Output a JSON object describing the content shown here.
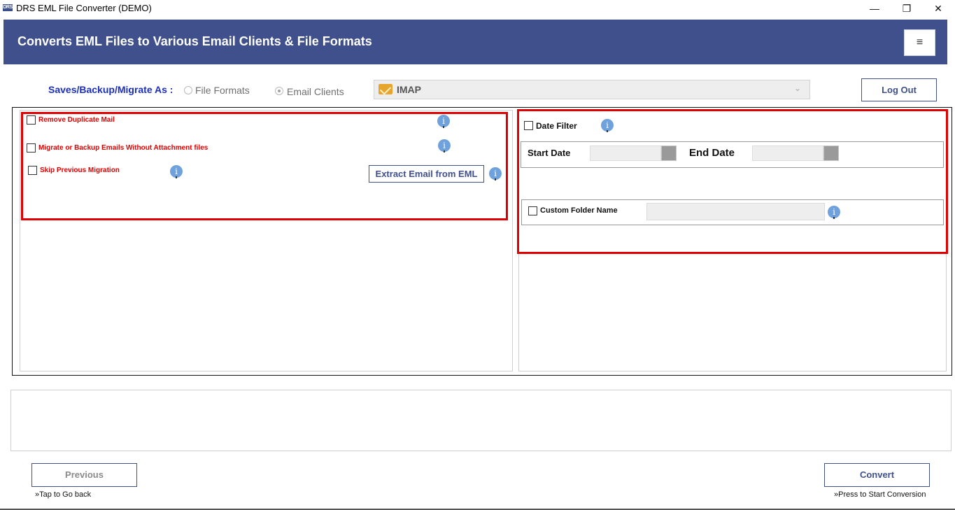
{
  "window": {
    "app_icon_text": "DRS",
    "title": "DRS EML File Converter (DEMO)",
    "minimize_glyph": "—",
    "maximize_glyph": "❐",
    "close_glyph": "✕"
  },
  "header": {
    "title": "Converts EML Files to Various Email Clients & File Formats",
    "menu_glyph": "≡",
    "background_color": "#40508c"
  },
  "saves": {
    "label": "Saves/Backup/Migrate As :",
    "options": [
      {
        "label": "File Formats",
        "selected": false
      },
      {
        "label": "Email Clients",
        "selected": true
      }
    ],
    "selected_client": "IMAP",
    "selected_client_icon": "imap-envelope-icon",
    "dropdown_glyph": "⌄"
  },
  "logout_label": "Log Out",
  "left_options": [
    {
      "label": "Remove Duplicate Mail",
      "checked": false
    },
    {
      "label": "Migrate or Backup Emails Without Attachment files",
      "checked": false
    },
    {
      "label": "Skip Previous Migration",
      "checked": false
    }
  ],
  "info_glyph": "i",
  "extract_label": "Extract Email from EML",
  "right_options": {
    "date_filter_label": "Date Filter",
    "date_filter_checked": false,
    "start_date_label": "Start Date",
    "start_date_value": "",
    "end_date_label": "End Date",
    "end_date_value": "",
    "custom_folder_label": "Custom Folder Name",
    "custom_folder_checked": false,
    "custom_folder_value": ""
  },
  "footer": {
    "previous_label": "Previous",
    "previous_hint": "»Tap to Go back",
    "convert_label": "Convert",
    "convert_hint": "»Press to Start Conversion"
  },
  "colors": {
    "accent": "#40508c",
    "highlight_border": "#e00000",
    "saves_label": "#1b2fbf"
  }
}
